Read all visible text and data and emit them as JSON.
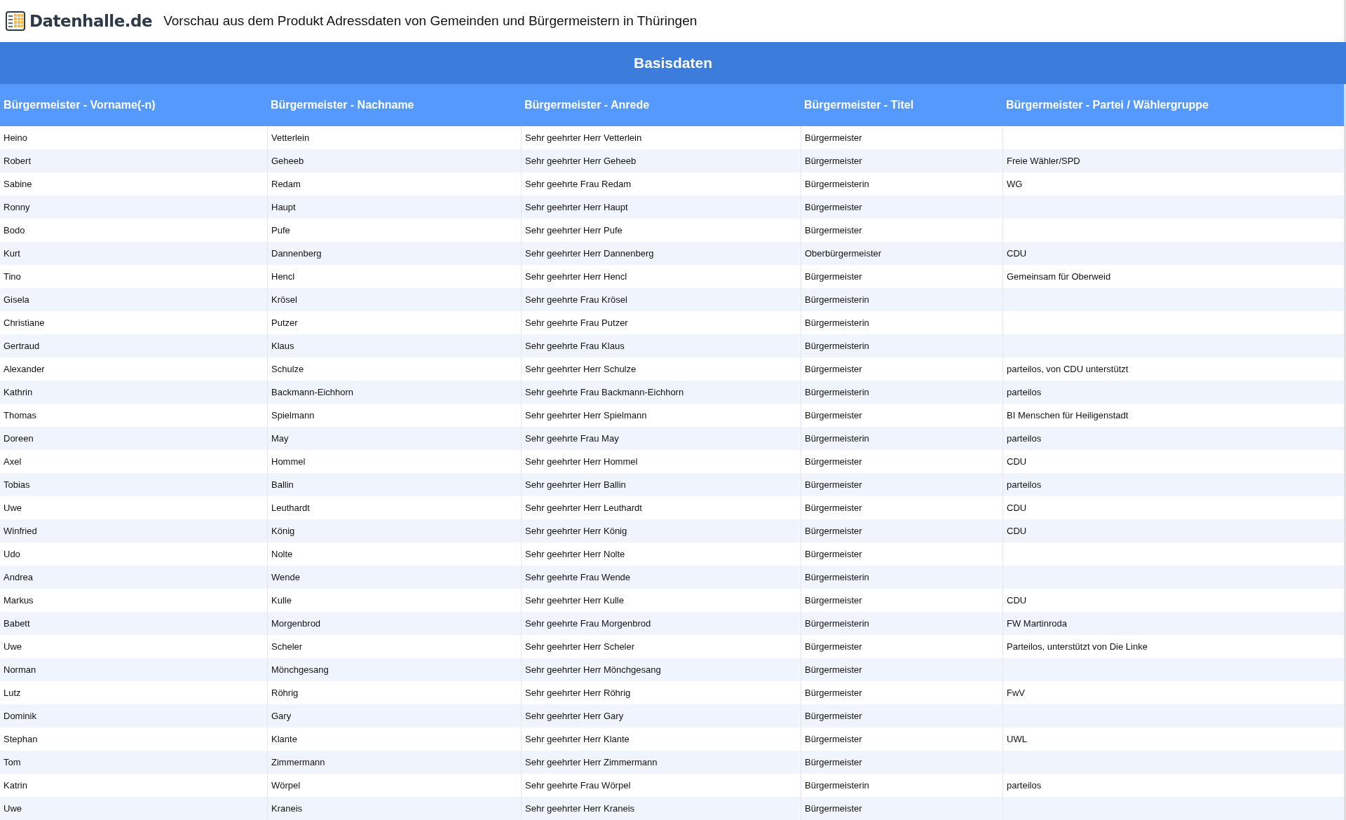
{
  "header": {
    "logo_text": "Datenhalle.de",
    "title": "Vorschau aus dem Produkt Adressdaten von Gemeinden und Bürgermeistern in Thüringen"
  },
  "section_title": "Basisdaten",
  "table": {
    "columns": [
      "Bürgermeister - Vorname(-n)",
      "Bürgermeister - Nachname",
      "Bürgermeister - Anrede",
      "Bürgermeister - Titel",
      "Bürgermeister - Partei / Wählergruppe"
    ],
    "rows": [
      [
        "Heino",
        "Vetterlein",
        "Sehr geehrter Herr Vetterlein",
        "Bürgermeister"
      ],
      [
        "Robert",
        "Geheeb",
        "Sehr geehrter Herr Geheeb",
        "Bürgermeister",
        "Freie Wähler/SPD"
      ],
      [
        "Sabine",
        "Redam",
        "Sehr geehrte Frau Redam",
        "Bürgermeisterin",
        "WG"
      ],
      [
        "Ronny",
        "Haupt",
        "Sehr geehrter Herr Haupt",
        "Bürgermeister"
      ],
      [
        "Bodo",
        "Pufe",
        "Sehr geehrter Herr Pufe",
        "Bürgermeister"
      ],
      [
        "Kurt",
        "Dannenberg",
        "Sehr geehrter Herr Dannenberg",
        "Oberbürgermeister",
        "CDU"
      ],
      [
        "Tino",
        "Hencl",
        "Sehr geehrter Herr Hencl",
        "Bürgermeister",
        "Gemeinsam für Oberweid"
      ],
      [
        "Gisela",
        "Krösel",
        "Sehr geehrte Frau Krösel",
        "Bürgermeisterin"
      ],
      [
        "Christiane",
        "Putzer",
        "Sehr geehrte Frau Putzer",
        "Bürgermeisterin"
      ],
      [
        "Gertraud",
        "Klaus",
        "Sehr geehrte Frau Klaus",
        "Bürgermeisterin"
      ],
      [
        "Alexander",
        "Schulze",
        "Sehr geehrter Herr Schulze",
        "Bürgermeister",
        "parteilos, von CDU unterstützt"
      ],
      [
        "Kathrin",
        "Backmann-Eichhorn",
        "Sehr geehrte Frau Backmann-Eichhorn",
        "Bürgermeisterin",
        "parteilos"
      ],
      [
        "Thomas",
        "Spielmann",
        "Sehr geehrter Herr Spielmann",
        "Bürgermeister",
        "BI Menschen für Heiligenstadt"
      ],
      [
        "Doreen",
        "May",
        "Sehr geehrte Frau May",
        "Bürgermeisterin",
        "parteilos"
      ],
      [
        "Axel",
        "Hommel",
        "Sehr geehrter Herr Hommel",
        "Bürgermeister",
        "CDU"
      ],
      [
        "Tobias",
        "Ballin",
        "Sehr geehrter Herr Ballin",
        "Bürgermeister",
        "parteilos"
      ],
      [
        "Uwe",
        "Leuthardt",
        "Sehr geehrter Herr Leuthardt",
        "Bürgermeister",
        "CDU"
      ],
      [
        "Winfried",
        "König",
        "Sehr geehrter Herr König",
        "Bürgermeister",
        "CDU"
      ],
      [
        "Udo",
        "Nolte",
        "Sehr geehrter Herr Nolte",
        "Bürgermeister"
      ],
      [
        "Andrea",
        "Wende",
        "Sehr geehrte Frau Wende",
        "Bürgermeisterin"
      ],
      [
        "Markus",
        "Kulle",
        "Sehr geehrter Herr Kulle",
        "Bürgermeister",
        "CDU"
      ],
      [
        "Babett",
        "Morgenbrod",
        "Sehr geehrte Frau Morgenbrod",
        "Bürgermeisterin",
        "FW Martinroda"
      ],
      [
        "Uwe",
        "Scheler",
        "Sehr geehrter Herr Scheler",
        "Bürgermeister",
        "Parteilos, unterstützt von Die Linke"
      ],
      [
        "Norman",
        "Mönchgesang",
        "Sehr geehrter Herr Mönchgesang",
        "Bürgermeister"
      ],
      [
        "Lutz",
        "Röhrig",
        "Sehr geehrter Herr Röhrig",
        "Bürgermeister",
        "FwV"
      ],
      [
        "Dominik",
        "Gary",
        "Sehr geehrter Herr Gary",
        "Bürgermeister"
      ],
      [
        "Stephan",
        "Klante",
        "Sehr geehrter Herr Klante",
        "Bürgermeister",
        "UWL"
      ],
      [
        "Tom",
        "Zimmermann",
        "Sehr geehrter Herr Zimmermann",
        "Bürgermeister"
      ],
      [
        "Katrin",
        "Wörpel",
        "Sehr geehrte Frau Wörpel",
        "Bürgermeisterin",
        "parteilos"
      ],
      [
        "Uwe",
        "Kraneis",
        "Sehr geehrter Herr Kraneis",
        "Bürgermeister"
      ]
    ]
  }
}
